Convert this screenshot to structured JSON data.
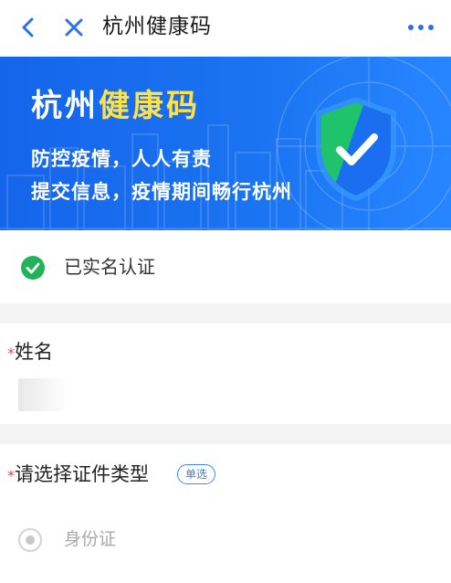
{
  "nav": {
    "title": "杭州健康码",
    "back_icon": "chevron-left-icon",
    "close_icon": "close-icon",
    "more_icon": "more-dots-icon",
    "accent_color": "#2c71e9"
  },
  "banner": {
    "title_part1": "杭州",
    "title_part2": "健康码",
    "line1": "防控疫情，人人有责",
    "line2": "提交信息，疫情期间畅行杭州",
    "colors": {
      "bg": "#1a6ef0",
      "highlight": "#ffe24a",
      "shield_green": "#1fc36b"
    },
    "shield_icon": "shield-check-icon"
  },
  "verified": {
    "icon": "check-circle-icon",
    "label": "已实名认证",
    "color": "#21b35a"
  },
  "name_field": {
    "required_mark": "*",
    "label": "姓名"
  },
  "id_type": {
    "required_mark": "*",
    "label": "请选择证件类型",
    "badge": "单选",
    "options": [
      {
        "label": "身份证",
        "selected": false
      }
    ]
  }
}
